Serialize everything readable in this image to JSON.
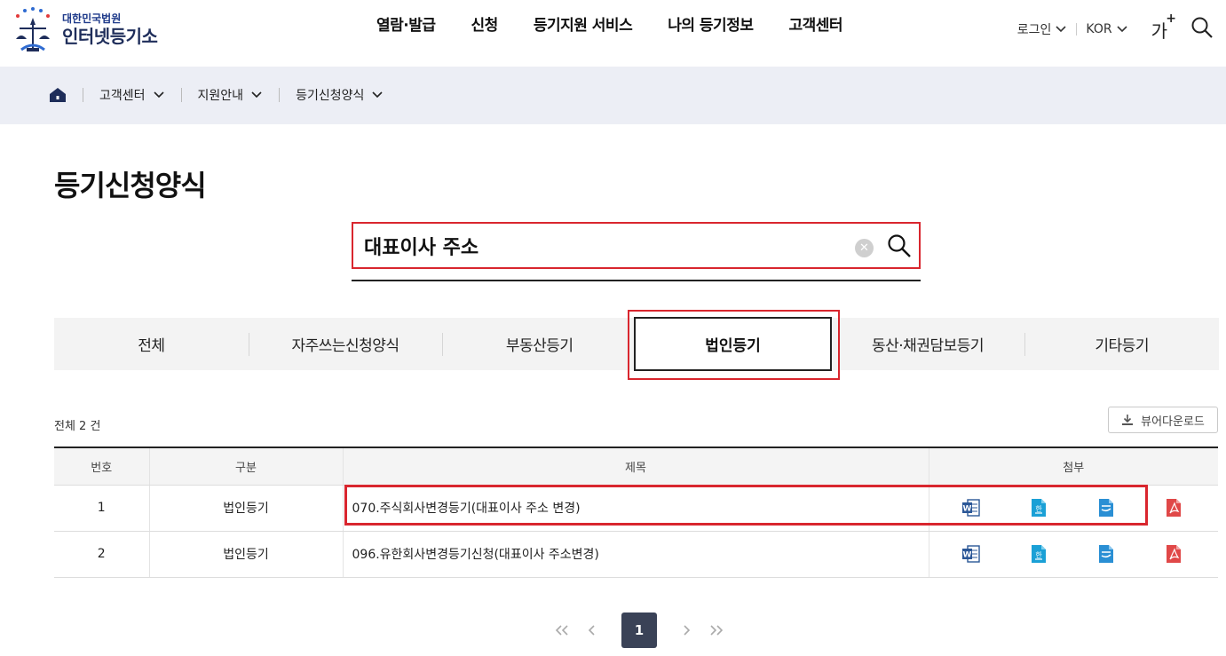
{
  "header": {
    "logo_small": "대한민국법원",
    "logo_big": "인터넷등기소",
    "nav": [
      "열람·발급",
      "신청",
      "등기지원 서비스",
      "나의 등기정보",
      "고객센터"
    ],
    "login": "로그인",
    "lang": "KOR",
    "font_size_label": "가",
    "font_size_plus": "+"
  },
  "breadcrumb": {
    "items": [
      "고객센터",
      "지원안내",
      "등기신청양식"
    ]
  },
  "page_title": "등기신청양식",
  "search": {
    "value": "대표이사 주소",
    "clear_symbol": "✕"
  },
  "tabs": [
    "전체",
    "자주쓰는신청양식",
    "부동산등기",
    "법인등기",
    "동산·채권담보등기",
    "기타등기"
  ],
  "active_tab": "법인등기",
  "total_text": "전체 2 건",
  "viewer_download": "뷰어다운로드",
  "table": {
    "headers": [
      "번호",
      "구분",
      "제목",
      "첨부"
    ],
    "rows": [
      {
        "no": "1",
        "category": "법인등기",
        "title": "070.주식회사변경등기(대표이사 주소 변경)"
      },
      {
        "no": "2",
        "category": "법인등기",
        "title": "096.유한회사변경등기신청(대표이사 주소변경)"
      }
    ],
    "attachment_icons": [
      "word-icon",
      "hwp-icon",
      "odt-icon",
      "pdf-icon"
    ]
  },
  "pagination": {
    "current": "1"
  },
  "colors": {
    "highlight": "#d9262e",
    "breadcrumb_bg": "#eceef5",
    "pager_active": "#3a4257"
  }
}
